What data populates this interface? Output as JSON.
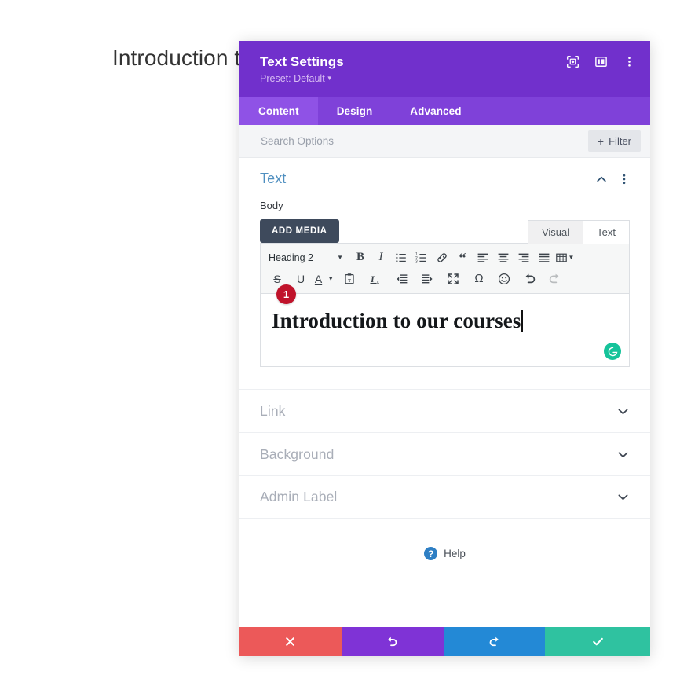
{
  "background": {
    "heading": "Introduction to"
  },
  "panel": {
    "title": "Text Settings",
    "preset_label": "Preset: Default",
    "header_icons": [
      {
        "name": "focus-target-icon",
        "title": "Focus"
      },
      {
        "name": "panel-layout-icon",
        "title": "Layout"
      },
      {
        "name": "kebab-menu-icon",
        "title": "More options"
      }
    ],
    "tabs": [
      {
        "label": "Content",
        "active": true
      },
      {
        "label": "Design",
        "active": false
      },
      {
        "label": "Advanced",
        "active": false
      }
    ],
    "search": {
      "placeholder": "Search Options",
      "value": ""
    },
    "filter_button": {
      "label": "Filter",
      "plus": "+"
    },
    "text_section": {
      "title": "Text",
      "field_label": "Body",
      "add_media_label": "ADD MEDIA",
      "editor_tabs": [
        {
          "label": "Visual",
          "active": false
        },
        {
          "label": "Text",
          "active": true
        }
      ],
      "toolbar_row1": [
        {
          "name": "format-select",
          "label": "Heading 2",
          "type": "select"
        },
        {
          "name": "bold-button",
          "glyph": "B",
          "type": "text",
          "style": "bold-serif"
        },
        {
          "name": "italic-button",
          "glyph": "I",
          "type": "text",
          "style": "italic-serif"
        },
        {
          "name": "bullet-list-button",
          "type": "icon"
        },
        {
          "name": "numbered-list-button",
          "type": "icon"
        },
        {
          "name": "link-button",
          "type": "icon"
        },
        {
          "name": "blockquote-button",
          "glyph": "“",
          "type": "text",
          "style": "quote"
        },
        {
          "name": "align-left-button",
          "type": "icon"
        },
        {
          "name": "align-center-button",
          "type": "icon"
        },
        {
          "name": "align-right-button",
          "type": "icon"
        },
        {
          "name": "align-justify-button",
          "type": "icon"
        },
        {
          "name": "table-button",
          "type": "icon",
          "has_caret": true
        }
      ],
      "toolbar_row2": [
        {
          "name": "strikethrough-button",
          "glyph": "S",
          "type": "text"
        },
        {
          "name": "underline-button",
          "glyph": "U",
          "type": "text"
        },
        {
          "name": "text-color-button",
          "glyph": "A",
          "type": "text",
          "has_caret": true
        },
        {
          "name": "paste-as-text-button",
          "type": "icon"
        },
        {
          "name": "clear-formatting-button",
          "type": "icon"
        },
        {
          "name": "outdent-button",
          "type": "icon"
        },
        {
          "name": "indent-button",
          "type": "icon"
        },
        {
          "name": "fullscreen-button",
          "type": "icon"
        },
        {
          "name": "special-character-button",
          "glyph": "Ω",
          "type": "text"
        },
        {
          "name": "emoji-button",
          "type": "icon"
        },
        {
          "name": "undo-button",
          "type": "icon"
        },
        {
          "name": "redo-button",
          "type": "icon",
          "disabled": true
        }
      ],
      "editor_content": "Introduction to our courses",
      "step_badge": "1",
      "grammarly_icon": "grammarly-icon"
    },
    "collapsed_sections": [
      {
        "label": "Link"
      },
      {
        "label": "Background"
      },
      {
        "label": "Admin Label"
      }
    ],
    "help": {
      "label": "Help",
      "icon_glyph": "?"
    },
    "footer_buttons": [
      {
        "name": "cancel-button",
        "icon": "close-icon",
        "color": "#ec5959"
      },
      {
        "name": "undo-button",
        "icon": "undo-icon",
        "color": "#7f33d6"
      },
      {
        "name": "redo-button",
        "icon": "redo-icon",
        "color": "#2389d6"
      },
      {
        "name": "save-button",
        "icon": "check-icon",
        "color": "#2fc2a0"
      }
    ]
  },
  "colors": {
    "header_purple": "#7130cc",
    "tabbar_purple": "#7f41d9",
    "tab_active_purple": "#8f52e6",
    "section_title_blue": "#4f8fc0",
    "badge_red": "#c0132b",
    "grammarly_green": "#15c39a"
  }
}
